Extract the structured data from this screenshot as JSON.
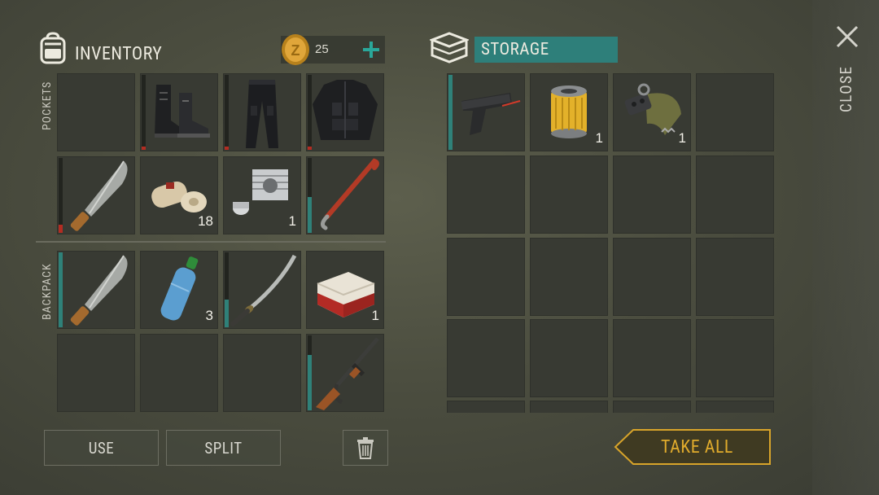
{
  "inventory": {
    "title": "INVENTORY",
    "coins": "25",
    "add_label": "+",
    "pockets_label": "POCKETS",
    "backpack_label": "BACKPACK"
  },
  "pockets": [
    {
      "item": "empty",
      "qty": ""
    },
    {
      "item": "boots",
      "qty": ""
    },
    {
      "item": "pants",
      "qty": ""
    },
    {
      "item": "tactical-vest",
      "qty": ""
    },
    {
      "item": "machete",
      "qty": ""
    },
    {
      "item": "bandages",
      "qty": "18"
    },
    {
      "item": "engine-cylinder",
      "qty": "1"
    },
    {
      "item": "crowbar",
      "qty": ""
    }
  ],
  "backpack": [
    {
      "item": "machete",
      "qty": ""
    },
    {
      "item": "water-bottle",
      "qty": "3"
    },
    {
      "item": "katana",
      "qty": ""
    },
    {
      "item": "cigarettes",
      "qty": "1"
    },
    {
      "item": "empty",
      "qty": ""
    },
    {
      "item": "empty",
      "qty": ""
    },
    {
      "item": "empty",
      "qty": ""
    },
    {
      "item": "assault-rifle",
      "qty": ""
    }
  ],
  "storage": {
    "title": "STORAGE",
    "items": [
      {
        "item": "pistol",
        "qty": ""
      },
      {
        "item": "oil-filter",
        "qty": "1"
      },
      {
        "item": "drum-magazine",
        "qty": "1"
      }
    ]
  },
  "actions": {
    "use": "USE",
    "split": "SPLIT",
    "take_all": "TAKE ALL",
    "close": "CLOSE"
  },
  "colors": {
    "accent_teal": "#2e7f7a",
    "gold": "#d8a42a",
    "durability_teal": "#2f8179",
    "durability_red": "#b32c22"
  }
}
